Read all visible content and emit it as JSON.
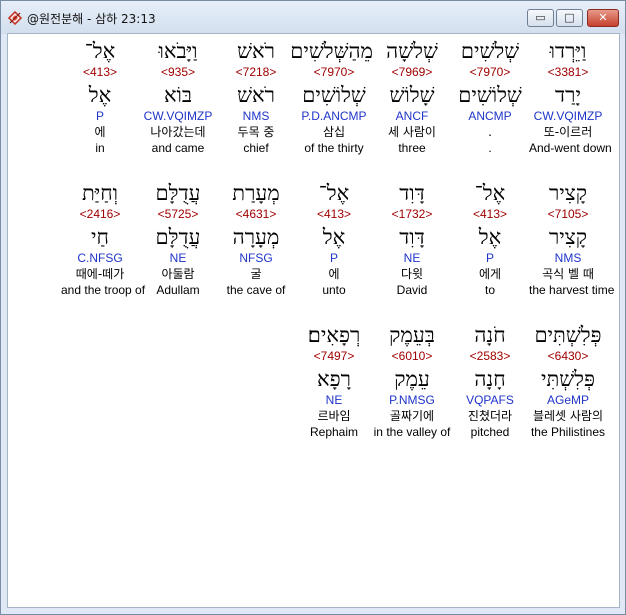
{
  "window": {
    "title": "@원전분해 - 삼하 23:13"
  },
  "controls": {
    "minimize": "▭",
    "maximize": "□",
    "close": "✕"
  },
  "rows": [
    [
      {
        "heb": "וַיֵּרְדוּ",
        "strong": "<3381>",
        "lemma": "יָרַד",
        "morph": "CW.VQIMZP",
        "kor": "또-이르러",
        "eng": "And-went down"
      },
      {
        "heb": "שְׁלֹשִׁים",
        "strong": "<7970>",
        "lemma": "שְׁלוֹשִׁים",
        "morph": "ANCMP",
        "kor": ".",
        "eng": "."
      },
      {
        "heb": "שְׁלֹשָׁה",
        "strong": "<7969>",
        "lemma": "שָׁלוֹשׁ",
        "morph": "ANCF",
        "kor": "세 사람이",
        "eng": "three"
      },
      {
        "heb": "מֵהַשְּׁלֹשִׁים",
        "strong": "<7970>",
        "lemma": "שְׁלוֹשִׁים",
        "morph": "P.D.ANCMP",
        "kor": "삼십",
        "eng": "of the thirty"
      },
      {
        "heb": "רֹאשׁ",
        "strong": "<7218>",
        "lemma": "רֹאשׁ",
        "morph": "NMS",
        "kor": "두목 중",
        "eng": "chief"
      },
      {
        "heb": "וַיָּבֹאוּ",
        "strong": "<935>",
        "lemma": "בּוֹא",
        "morph": "CW.VQIMZP",
        "kor": "나아갔는데",
        "eng": "and came"
      },
      {
        "heb": "אֶל־",
        "strong": "<413>",
        "lemma": "אֶל",
        "morph": "P",
        "kor": "에",
        "eng": "in"
      }
    ],
    [
      {
        "heb": "קָצִיר",
        "strong": "<7105>",
        "lemma": "קָצִיר",
        "morph": "NMS",
        "kor": "곡식 벨 때",
        "eng": "the harvest time"
      },
      {
        "heb": "אֶל־",
        "strong": "<413>",
        "lemma": "אֶל",
        "morph": "P",
        "kor": "에게",
        "eng": "to"
      },
      {
        "heb": "דָּוִד",
        "strong": "<1732>",
        "lemma": "דָּוִד",
        "morph": "NE",
        "kor": "다윗",
        "eng": "David"
      },
      {
        "heb": "אֶל־",
        "strong": "<413>",
        "lemma": "אֶל",
        "morph": "P",
        "kor": "에",
        "eng": "unto"
      },
      {
        "heb": "מְעָרַת",
        "strong": "<4631>",
        "lemma": "מְעָרָה",
        "morph": "NFSG",
        "kor": "굴",
        "eng": "the cave of"
      },
      {
        "heb": "עֲדֻלָּם",
        "strong": "<5725>",
        "lemma": "עֲדֻלָּם",
        "morph": "NE",
        "kor": "아둘람",
        "eng": "Adullam"
      },
      {
        "heb": "וְחַיַּת",
        "strong": "<2416>",
        "lemma": "חַי",
        "morph": "C.NFSG",
        "kor": "때에-떼가",
        "eng": "and the troop of"
      }
    ],
    [
      {
        "heb": "פְּלִשְׁתִּים",
        "strong": "<6430>",
        "lemma": "פְּלִשְׁתִּי",
        "morph": "AGeMP",
        "kor": "블레셋 사람의",
        "eng": "the Philistines"
      },
      {
        "heb": "חֹנָה",
        "strong": "<2583>",
        "lemma": "חָנָה",
        "morph": "VQPAFS",
        "kor": "진쳤더라",
        "eng": "pitched"
      },
      {
        "heb": "בְּעֵמֶק",
        "strong": "<6010>",
        "lemma": "עֵמֶק",
        "morph": "P.NMSG",
        "kor": "골짜기에",
        "eng": "in the valley of"
      },
      {
        "heb": "רְפָאִים׃",
        "strong": "<7497>",
        "lemma": "רָפָא",
        "morph": "NE",
        "kor": "르바임",
        "eng": "Rephaim"
      }
    ]
  ]
}
